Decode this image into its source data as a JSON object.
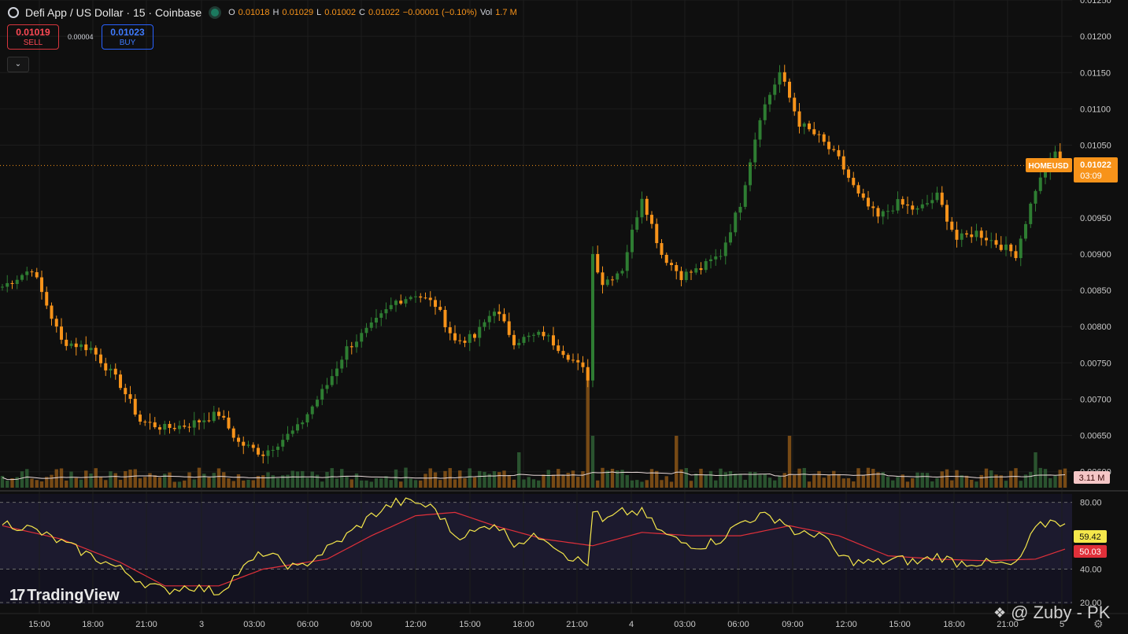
{
  "header": {
    "title": "Defi App / US Dollar · 15 · Coinbase",
    "o_label": "O",
    "o": "0.01018",
    "h_label": "H",
    "h": "0.01029",
    "l_label": "L",
    "l": "0.01002",
    "c_label": "C",
    "c": "0.01022",
    "change": "−0.00001 (−0.10%)",
    "vol_label": "Vol",
    "vol": "1.7 M"
  },
  "trade": {
    "sell_price": "0.01019",
    "sell_label": "SELL",
    "spread": "0.00004",
    "buy_price": "0.01023",
    "buy_label": "BUY"
  },
  "branding": {
    "logo": "TradingView",
    "watermark": "@ Zuby - PK"
  },
  "colors": {
    "up": "#2e7d32",
    "down": "#f7931a",
    "rsi": "#f5e74b",
    "rsi_ma": "#e0303a",
    "vol_ma": "#e8d9d9"
  },
  "chart_data": [
    {
      "type": "candlestick",
      "symbol_label": "HOMEUSD",
      "last_price": "0.01022",
      "countdown": "03:09",
      "y_ticks": [
        "0.01250",
        "0.01200",
        "0.01150",
        "0.01100",
        "0.01050",
        "0.00950",
        "0.00900",
        "0.00850",
        "0.00800",
        "0.00750",
        "0.00700",
        "0.00650",
        "0.00600"
      ],
      "ylim": [
        0.00578,
        0.0125
      ],
      "x_ticks": [
        "15:00",
        "18:00",
        "21:00",
        "3",
        "03:00",
        "06:00",
        "09:00",
        "12:00",
        "15:00",
        "18:00",
        "21:00",
        "4",
        "03:00",
        "06:00",
        "09:00",
        "12:00",
        "15:00",
        "18:00",
        "21:00",
        "5"
      ],
      "close_path": [
        [
          0,
          0.00855
        ],
        [
          6,
          0.0088
        ],
        [
          12,
          0.0078
        ],
        [
          18,
          0.0077
        ],
        [
          24,
          0.0072
        ],
        [
          28,
          0.0067
        ],
        [
          33,
          0.0066
        ],
        [
          38,
          0.00665
        ],
        [
          44,
          0.0068
        ],
        [
          48,
          0.0064
        ],
        [
          53,
          0.00625
        ],
        [
          60,
          0.0066
        ],
        [
          66,
          0.0072
        ],
        [
          70,
          0.0077
        ],
        [
          75,
          0.008
        ],
        [
          80,
          0.00835
        ],
        [
          84,
          0.00845
        ],
        [
          88,
          0.0083
        ],
        [
          92,
          0.0078
        ],
        [
          96,
          0.00785
        ],
        [
          100,
          0.00825
        ],
        [
          104,
          0.0078
        ],
        [
          110,
          0.0079
        ],
        [
          115,
          0.0076
        ],
        [
          118,
          0.0074
        ],
        [
          119,
          0.0073
        ],
        [
          120,
          0.009
        ],
        [
          122,
          0.0086
        ],
        [
          126,
          0.0088
        ],
        [
          130,
          0.0098
        ],
        [
          134,
          0.009
        ],
        [
          138,
          0.0087
        ],
        [
          142,
          0.0088
        ],
        [
          146,
          0.009
        ],
        [
          150,
          0.0097
        ],
        [
          154,
          0.0109
        ],
        [
          158,
          0.0115
        ],
        [
          162,
          0.0108
        ],
        [
          166,
          0.0106
        ],
        [
          170,
          0.0103
        ],
        [
          174,
          0.0098
        ],
        [
          178,
          0.0095
        ],
        [
          182,
          0.0097
        ],
        [
          186,
          0.0096
        ],
        [
          190,
          0.0098
        ],
        [
          194,
          0.0092
        ],
        [
          198,
          0.0093
        ],
        [
          202,
          0.00915
        ],
        [
          206,
          0.009
        ],
        [
          210,
          0.0099
        ],
        [
          214,
          0.0104
        ],
        [
          216,
          0.01022
        ]
      ],
      "volume_last": "3.11 M"
    },
    {
      "type": "line",
      "name": "RSI",
      "rsi_value": "59.42",
      "rsi_ma_value": "50.03",
      "y_ticks": [
        "80.00",
        "40.00",
        "20.00"
      ],
      "ylim": [
        20,
        85
      ],
      "rsi_path": [
        [
          0,
          68
        ],
        [
          6,
          64
        ],
        [
          12,
          56
        ],
        [
          18,
          48
        ],
        [
          24,
          40
        ],
        [
          28,
          33
        ],
        [
          33,
          27
        ],
        [
          38,
          30
        ],
        [
          44,
          26
        ],
        [
          48,
          38
        ],
        [
          53,
          50
        ],
        [
          60,
          40
        ],
        [
          66,
          52
        ],
        [
          70,
          60
        ],
        [
          75,
          72
        ],
        [
          80,
          80
        ],
        [
          84,
          80
        ],
        [
          88,
          76
        ],
        [
          92,
          60
        ],
        [
          96,
          62
        ],
        [
          100,
          68
        ],
        [
          104,
          56
        ],
        [
          110,
          60
        ],
        [
          115,
          48
        ],
        [
          118,
          44
        ],
        [
          119,
          42
        ],
        [
          120,
          76
        ],
        [
          122,
          68
        ],
        [
          126,
          74
        ],
        [
          130,
          74
        ],
        [
          134,
          62
        ],
        [
          138,
          56
        ],
        [
          142,
          54
        ],
        [
          146,
          58
        ],
        [
          150,
          68
        ],
        [
          154,
          72
        ],
        [
          158,
          70
        ],
        [
          162,
          60
        ],
        [
          166,
          62
        ],
        [
          170,
          48
        ],
        [
          174,
          44
        ],
        [
          178,
          44
        ],
        [
          182,
          46
        ],
        [
          186,
          44
        ],
        [
          190,
          48
        ],
        [
          194,
          44
        ],
        [
          198,
          44
        ],
        [
          202,
          43
        ],
        [
          206,
          42
        ],
        [
          210,
          64
        ],
        [
          214,
          70
        ],
        [
          216,
          66
        ]
      ],
      "rsi_ma_path": [
        [
          0,
          66
        ],
        [
          12,
          58
        ],
        [
          24,
          44
        ],
        [
          33,
          30
        ],
        [
          44,
          30
        ],
        [
          53,
          40
        ],
        [
          66,
          46
        ],
        [
          75,
          60
        ],
        [
          84,
          72
        ],
        [
          92,
          74
        ],
        [
          100,
          66
        ],
        [
          110,
          58
        ],
        [
          120,
          54
        ],
        [
          130,
          62
        ],
        [
          140,
          60
        ],
        [
          150,
          60
        ],
        [
          160,
          66
        ],
        [
          170,
          60
        ],
        [
          180,
          48
        ],
        [
          190,
          46
        ],
        [
          200,
          45
        ],
        [
          210,
          46
        ],
        [
          216,
          52
        ]
      ]
    }
  ]
}
